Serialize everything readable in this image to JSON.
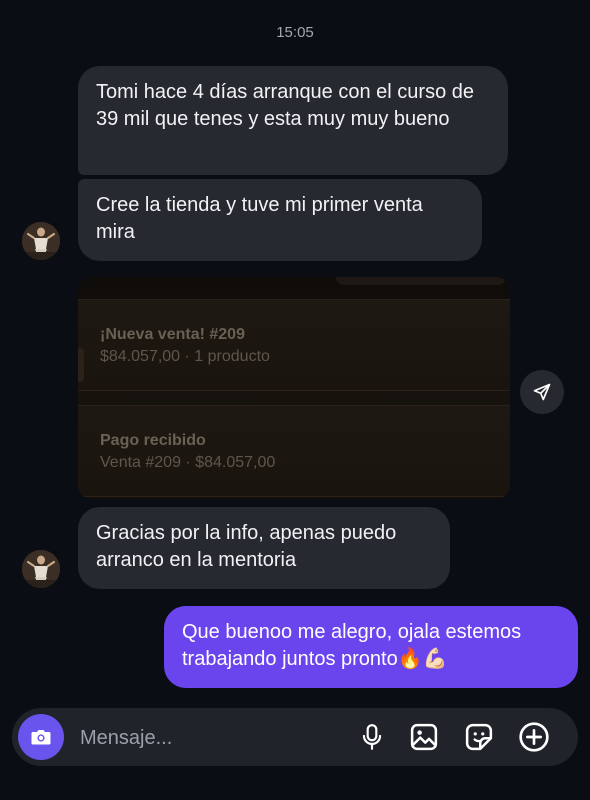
{
  "chat": {
    "timestamp": "15:05",
    "messages": [
      {
        "from": "contact",
        "text": "Tomi hace 4 días arranque con el curso de 39 mil que tenes y esta muy muy bueno"
      },
      {
        "from": "contact",
        "text": "Cree la tienda y tuve mi primer venta mira"
      },
      {
        "from": "contact",
        "text": "Gracias por la info, apenas puedo arranco en la mentoria"
      },
      {
        "from": "me",
        "text": "Que buenoo me alegro, ojala estemos trabajando juntos pronto🔥💪🏻"
      }
    ],
    "image": {
      "notifications": [
        {
          "title": "¡Nueva venta! #209",
          "subtitle": "$84.057,00 · 1 producto"
        },
        {
          "title": "Pago recibido",
          "subtitle": "Venta #209 · $84.057,00"
        }
      ]
    }
  },
  "composer": {
    "placeholder": "Mensaje..."
  },
  "icons": {
    "camera": "camera-icon",
    "mic": "microphone-icon",
    "gallery": "image-icon",
    "sticker": "sticker-icon",
    "plus": "plus-icon",
    "share": "send-icon"
  },
  "colors": {
    "background": "#0b0d15",
    "received_bubble": "#26292f",
    "sent_bubble": "#6a45ee",
    "accent": "#6a54ee"
  }
}
